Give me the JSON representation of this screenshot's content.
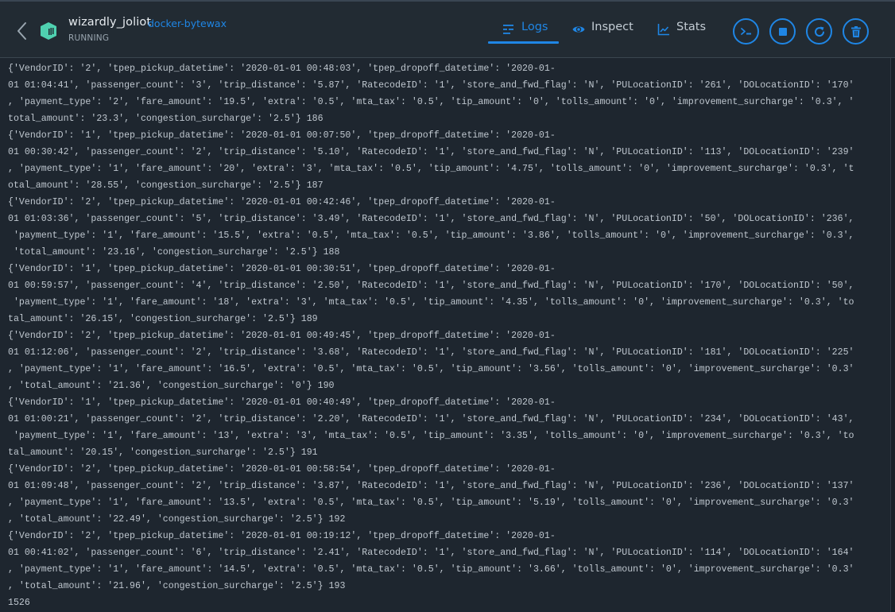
{
  "header": {
    "container_name": "wizardly_joliot",
    "image_name": "docker-bytewax",
    "status": "RUNNING",
    "icons": {
      "back": "chevron-left-icon",
      "container": "container-icon"
    },
    "tabs": [
      {
        "label": "Logs",
        "icon": "logs-icon",
        "active": true
      },
      {
        "label": "Inspect",
        "icon": "eye-icon",
        "active": false
      },
      {
        "label": "Stats",
        "icon": "chart-icon",
        "active": false
      }
    ],
    "actions": [
      {
        "name": "open-cli",
        "icon": "terminal-icon"
      },
      {
        "name": "stop",
        "icon": "stop-icon"
      },
      {
        "name": "restart",
        "icon": "restart-icon"
      },
      {
        "name": "delete",
        "icon": "trash-icon"
      }
    ]
  },
  "colors": {
    "accent": "#1f86e5",
    "container_icon": "#4fd1b0",
    "background": "#1e262f",
    "header_bg": "#222b33",
    "log_text": "#bfc7cf"
  },
  "logs": {
    "lines": [
      "{'VendorID': '2', 'tpep_pickup_datetime': '2020-01-01 00:48:03', 'tpep_dropoff_datetime': '2020-01-",
      "01 01:04:41', 'passenger_count': '3', 'trip_distance': '5.87', 'RatecodeID': '1', 'store_and_fwd_flag': 'N', 'PULocationID': '261', 'DOLocationID': '170'",
      ", 'payment_type': '2', 'fare_amount': '19.5', 'extra': '0.5', 'mta_tax': '0.5', 'tip_amount': '0', 'tolls_amount': '0', 'improvement_surcharge': '0.3', '",
      "total_amount': '23.3', 'congestion_surcharge': '2.5'} 186",
      "{'VendorID': '1', 'tpep_pickup_datetime': '2020-01-01 00:07:50', 'tpep_dropoff_datetime': '2020-01-",
      "01 00:30:42', 'passenger_count': '2', 'trip_distance': '5.10', 'RatecodeID': '1', 'store_and_fwd_flag': 'N', 'PULocationID': '113', 'DOLocationID': '239'",
      ", 'payment_type': '1', 'fare_amount': '20', 'extra': '3', 'mta_tax': '0.5', 'tip_amount': '4.75', 'tolls_amount': '0', 'improvement_surcharge': '0.3', 't",
      "otal_amount': '28.55', 'congestion_surcharge': '2.5'} 187",
      "{'VendorID': '2', 'tpep_pickup_datetime': '2020-01-01 00:42:46', 'tpep_dropoff_datetime': '2020-01-",
      "01 01:03:36', 'passenger_count': '5', 'trip_distance': '3.49', 'RatecodeID': '1', 'store_and_fwd_flag': 'N', 'PULocationID': '50', 'DOLocationID': '236',",
      " 'payment_type': '1', 'fare_amount': '15.5', 'extra': '0.5', 'mta_tax': '0.5', 'tip_amount': '3.86', 'tolls_amount': '0', 'improvement_surcharge': '0.3',",
      " 'total_amount': '23.16', 'congestion_surcharge': '2.5'} 188",
      "{'VendorID': '1', 'tpep_pickup_datetime': '2020-01-01 00:30:51', 'tpep_dropoff_datetime': '2020-01-",
      "01 00:59:57', 'passenger_count': '4', 'trip_distance': '2.50', 'RatecodeID': '1', 'store_and_fwd_flag': 'N', 'PULocationID': '170', 'DOLocationID': '50',",
      " 'payment_type': '1', 'fare_amount': '18', 'extra': '3', 'mta_tax': '0.5', 'tip_amount': '4.35', 'tolls_amount': '0', 'improvement_surcharge': '0.3', 'to",
      "tal_amount': '26.15', 'congestion_surcharge': '2.5'} 189",
      "{'VendorID': '2', 'tpep_pickup_datetime': '2020-01-01 00:49:45', 'tpep_dropoff_datetime': '2020-01-",
      "01 01:12:06', 'passenger_count': '2', 'trip_distance': '3.68', 'RatecodeID': '1', 'store_and_fwd_flag': 'N', 'PULocationID': '181', 'DOLocationID': '225'",
      ", 'payment_type': '1', 'fare_amount': '16.5', 'extra': '0.5', 'mta_tax': '0.5', 'tip_amount': '3.56', 'tolls_amount': '0', 'improvement_surcharge': '0.3'",
      ", 'total_amount': '21.36', 'congestion_surcharge': '0'} 190",
      "{'VendorID': '1', 'tpep_pickup_datetime': '2020-01-01 00:40:49', 'tpep_dropoff_datetime': '2020-01-",
      "01 01:00:21', 'passenger_count': '2', 'trip_distance': '2.20', 'RatecodeID': '1', 'store_and_fwd_flag': 'N', 'PULocationID': '234', 'DOLocationID': '43',",
      " 'payment_type': '1', 'fare_amount': '13', 'extra': '3', 'mta_tax': '0.5', 'tip_amount': '3.35', 'tolls_amount': '0', 'improvement_surcharge': '0.3', 'to",
      "tal_amount': '20.15', 'congestion_surcharge': '2.5'} 191",
      "{'VendorID': '2', 'tpep_pickup_datetime': '2020-01-01 00:58:54', 'tpep_dropoff_datetime': '2020-01-",
      "01 01:09:48', 'passenger_count': '2', 'trip_distance': '3.87', 'RatecodeID': '1', 'store_and_fwd_flag': 'N', 'PULocationID': '236', 'DOLocationID': '137'",
      ", 'payment_type': '1', 'fare_amount': '13.5', 'extra': '0.5', 'mta_tax': '0.5', 'tip_amount': '5.19', 'tolls_amount': '0', 'improvement_surcharge': '0.3'",
      ", 'total_amount': '22.49', 'congestion_surcharge': '2.5'} 192",
      "{'VendorID': '2', 'tpep_pickup_datetime': '2020-01-01 00:19:12', 'tpep_dropoff_datetime': '2020-01-",
      "01 00:41:02', 'passenger_count': '6', 'trip_distance': '2.41', 'RatecodeID': '1', 'store_and_fwd_flag': 'N', 'PULocationID': '114', 'DOLocationID': '164'",
      ", 'payment_type': '1', 'fare_amount': '14.5', 'extra': '0.5', 'mta_tax': '0.5', 'tip_amount': '3.66', 'tolls_amount': '0', 'improvement_surcharge': '0.3'",
      ", 'total_amount': '21.96', 'congestion_surcharge': '2.5'} 193",
      "1526"
    ]
  }
}
